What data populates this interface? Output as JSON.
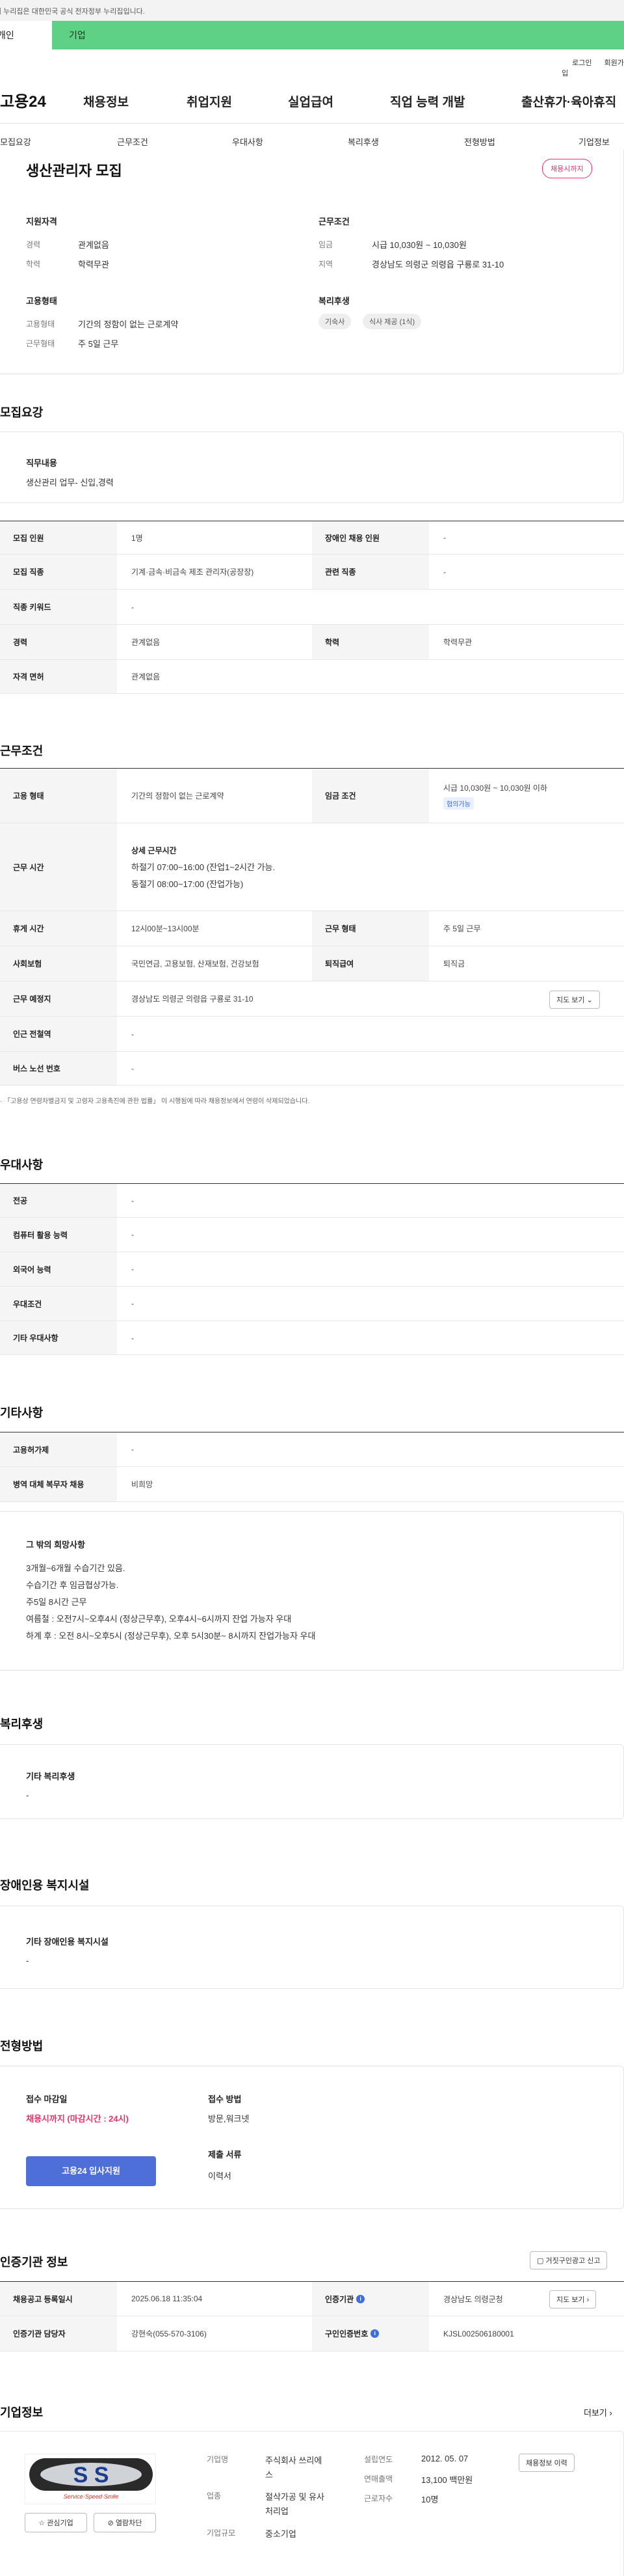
{
  "notice": "이 누리집은 대한민국 공식 전자정부 누리집입니다.",
  "tabs": {
    "personal": "개인",
    "corporate": "기업"
  },
  "util": {
    "login": "로그인",
    "signup": "회원가입"
  },
  "gnb": {
    "logo": "고용24",
    "menu": [
      "채용정보",
      "취업지원",
      "실업급여",
      "직업 능력 개발",
      "출산휴가·육아휴직"
    ]
  },
  "anchor": [
    "모집요강",
    "근무조건",
    "우대사항",
    "복리후생",
    "전형방법",
    "기업정보"
  ],
  "summary": {
    "title": "생산관리자 모집",
    "badge": "채용시까지",
    "qual_title": "지원자격",
    "qual": [
      {
        "label": "경력",
        "value": "관계없음"
      },
      {
        "label": "학력",
        "value": "학력무관"
      }
    ],
    "cond_title": "근무조건",
    "cond": [
      {
        "label": "임금",
        "value": "시급 10,030원 ~ 10,030원"
      },
      {
        "label": "지역",
        "value": "경상남도 의령군 의령읍 구룡로 31-10"
      }
    ],
    "emp_title": "고용형태",
    "emp": [
      {
        "label": "고용형태",
        "value": "기간의 정함이 없는 근로계약"
      },
      {
        "label": "근무형태",
        "value": "주 5일 근무"
      }
    ],
    "welfare_title": "복리후생",
    "welfare_tags": [
      "기숙사",
      "식사 제공 (1식)"
    ]
  },
  "recruit": {
    "title": "모집요강",
    "job_title": "직무내용",
    "job_desc": "생산관리 업무- 신입,경력",
    "rows": {
      "count_l": "모집 인원",
      "count_v": "1명",
      "disab_l": "장애인 채용 인원",
      "disab_v": "-",
      "job_l": "모집 직종",
      "job_v": "기계·금속·비금속 제조 관리자(공장장)",
      "rel_l": "관련 직종",
      "rel_v": "-",
      "kw_l": "직종 키워드",
      "kw_v": "-",
      "exp_l": "경력",
      "exp_v": "관계없음",
      "edu_l": "학력",
      "edu_v": "학력무관",
      "lic_l": "자격 면허",
      "lic_v": "관계없음"
    }
  },
  "work": {
    "title": "근무조건",
    "emp_l": "고용 형태",
    "emp_v": "기간의 정함이 없는 근로계약",
    "wage_l": "임금 조건",
    "wage_v": "시급 10,030원 ~ 10,030원 이하",
    "wage_tag": "협의가능",
    "hours_l": "근무 시간",
    "hours_sub": "상세 근무시간",
    "hours_1": "하절기 07:00~16:00 (잔업1~2시간 가능.",
    "hours_2": "동절기 08:00~17:00 (잔업가능)",
    "break_l": "휴게 시간",
    "break_v": "12시00분~13시00분",
    "type_l": "근무 형태",
    "type_v": "주 5일 근무",
    "ins_l": "사회보험",
    "ins_v": "국민연금, 고용보험, 산재보험, 건강보험",
    "ret_l": "퇴직급여",
    "ret_v": "퇴직금",
    "place_l": "근무 예정지",
    "place_v": "경상남도 의령군 의령읍 구룡로 31-10",
    "map_btn": "지도 보기",
    "station_l": "인근 전철역",
    "station_v": "-",
    "bus_l": "버스 노선 번호",
    "bus_v": "-",
    "footnote": "「고용상 연령차별금지 및 고령자 고용촉진에 관한 법률」 이 시행됨에 따라 채용정보에서 연령이 삭제되었습니다."
  },
  "pref": {
    "title": "우대사항",
    "rows": [
      {
        "l": "전공",
        "v": "-"
      },
      {
        "l": "컴퓨터 활용 능력",
        "v": "-"
      },
      {
        "l": "외국어 능력",
        "v": "-"
      },
      {
        "l": "우대조건",
        "v": "-"
      },
      {
        "l": "기타 우대사항",
        "v": "-"
      }
    ]
  },
  "etc": {
    "title": "기타사항",
    "rows": [
      {
        "l": "고용허가제",
        "v": "-"
      },
      {
        "l": "병역 대체 복무자 채용",
        "v": "비희망"
      }
    ],
    "other_title": "그 밖의 희망사항",
    "other_lines": [
      "3개월~6개월 수습기간  있음.",
      "수습기간 후 임금협상가능.",
      "주5일 8시간 근무",
      "여름철 : 오전7시~오후4시 (정상근무후), 오후4시~6시까지 잔업 가능자 우대",
      "하계 후 : 오전 8시~오후5시 (정상근무후), 오후 5시30분~ 8시까지 잔업가능자 우대"
    ]
  },
  "welfare": {
    "title": "복리후생",
    "sub": "기타 복리후생",
    "val": "-"
  },
  "disab": {
    "title": "장애인용 복지시설",
    "sub": "기타 장애인용 복지시설",
    "val": "-"
  },
  "selection": {
    "title": "전형방법",
    "deadline_l": "접수 마감일",
    "deadline_v": "채용시까지 (마감시간 : 24시)",
    "apply_btn": "고용24 입사지원",
    "method_l": "접수 방법",
    "method_v": "방문,워크넷",
    "docs_l": "제출 서류",
    "docs_v": "이력서"
  },
  "agency": {
    "title": "인증기관 정보",
    "report_btn": "거짓구인광고 신고",
    "date_l": "채용공고 등록일시",
    "date_v": "2025.06.18 11:35:04",
    "agency_l": "인증기관",
    "agency_v": "경상남도 의령군청",
    "map_btn": "지도 보기",
    "mgr_l": "인증기관 담당자",
    "mgr_v": "강현숙(055-570-3106)",
    "no_l": "구인인증번호",
    "no_v": "KJSL002506180001"
  },
  "company": {
    "title": "기업정보",
    "more": "더보기",
    "logo_sub": "Service·Speed·Smile",
    "fav_btn": "관심기업",
    "block_btn": "열람차단",
    "name_l": "기업명",
    "name_v1": "주식회사 쓰리에",
    "name_v2": "스",
    "ind_l": "업종",
    "ind_v1": "절삭가공 및 유사",
    "ind_v2": "처리업",
    "size_l": "기업규모",
    "size_v": "중소기업",
    "est_l": "설립연도",
    "est_v": "2012. 05. 07",
    "sales_l": "연매출액",
    "sales_v": "13,100 백만원",
    "emp_l": "근로자수",
    "emp_v": "10명",
    "history_btn": "채용정보 이력"
  }
}
